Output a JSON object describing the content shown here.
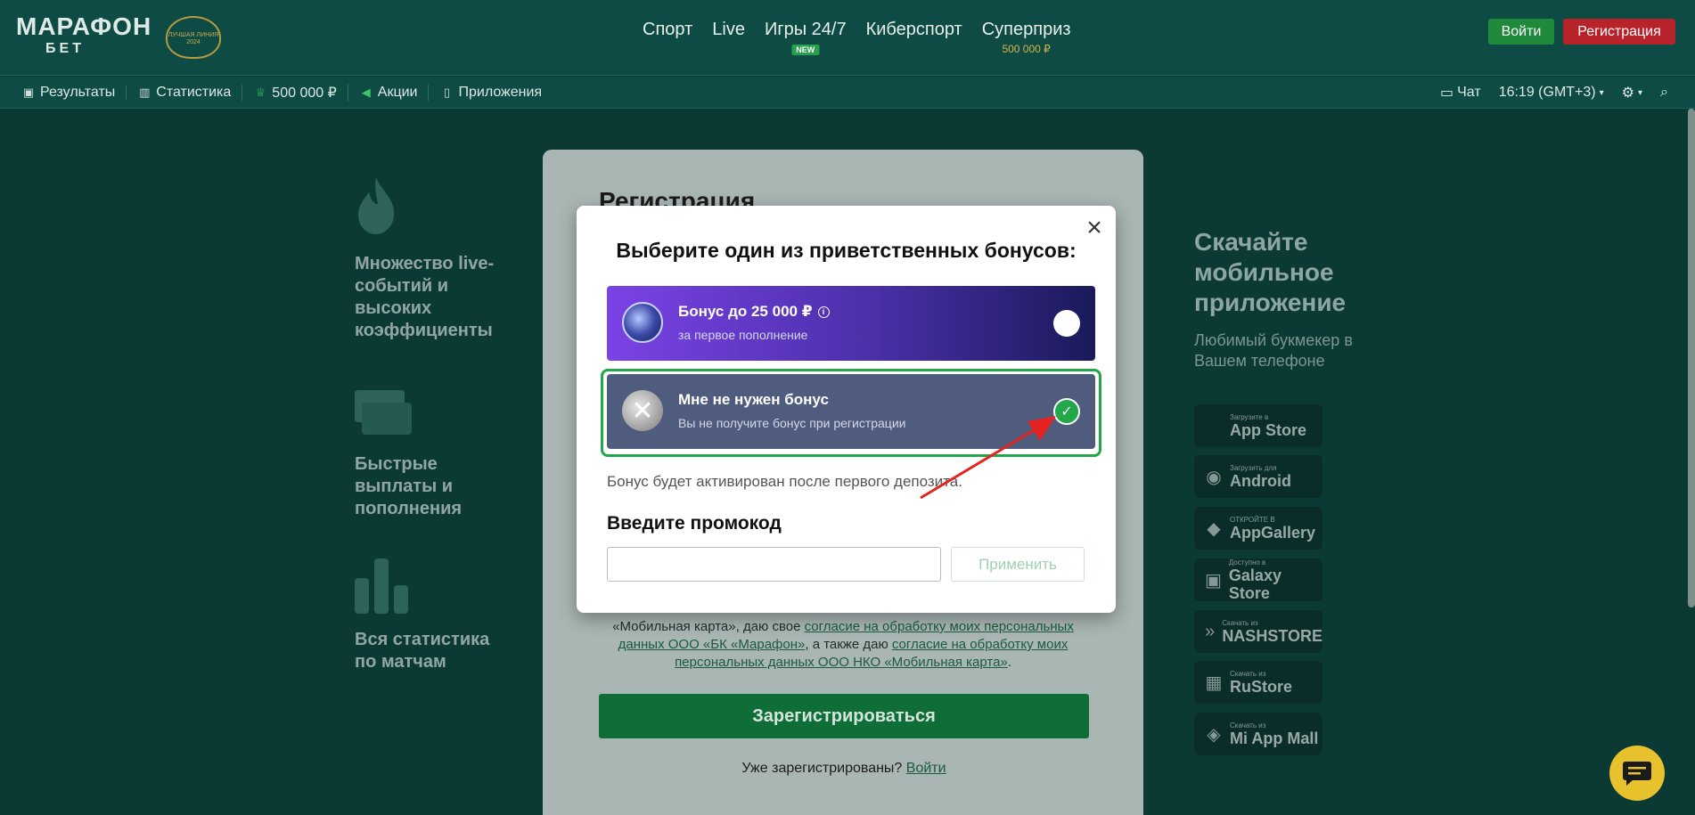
{
  "header": {
    "logo_top": "МАРАФОН",
    "logo_bottom": "БЕТ",
    "award_text": "ЛУЧШАЯ ЛИНИЯ 2024",
    "nav": [
      {
        "label": "Спорт"
      },
      {
        "label": "Live"
      },
      {
        "label": "Игры 24/7",
        "badge": "NEW"
      },
      {
        "label": "Киберспорт"
      },
      {
        "label": "Суперприз",
        "sub": "500 000 ₽"
      }
    ],
    "login_label": "Войти",
    "register_label": "Регистрация"
  },
  "subnav": {
    "left": [
      {
        "label": "Результаты",
        "icon": "results-icon"
      },
      {
        "label": "Статистика",
        "icon": "stats-icon"
      },
      {
        "label": "500 000 ₽",
        "icon": "trophy-icon"
      },
      {
        "label": "Акции",
        "icon": "megaphone-icon"
      },
      {
        "label": "Приложения",
        "icon": "phone-icon"
      }
    ],
    "chat_label": "Чат",
    "time_label": "16:19 (GMT+3)"
  },
  "features": [
    {
      "text": "Множество live-событий и высоких коэффициенты"
    },
    {
      "text": "Быстрые выплаты и пополнения"
    },
    {
      "text": "Вся статистика по матчам"
    }
  ],
  "download": {
    "title": "Скачайте мобильное приложение",
    "subtitle": "Любимый букмекер в Вашем телефоне",
    "stores": [
      {
        "small": "Загрузите в",
        "big": "App Store"
      },
      {
        "small": "Загрузить для",
        "big": "Android"
      },
      {
        "small": "ОТКРОЙТЕ В",
        "big": "AppGallery"
      },
      {
        "small": "Доступно в",
        "big": "Galaxy Store"
      },
      {
        "small": "Скачать из",
        "big": "NASHSTORE"
      },
      {
        "small": "Скачать из",
        "big": "RuStore"
      },
      {
        "small": "Скачать из",
        "big": "Mi App Mall"
      }
    ]
  },
  "registration": {
    "title": "Регистрация",
    "legal_1": "«Мобильная карта», даю свое",
    "legal_link_1": "согласие на обработку моих персональных данных ООО «БК «Марафон»",
    "legal_2": ", а также даю",
    "legal_link_2": "согласие на обработку моих персональных данных ООО НКО «Мобильная карта»",
    "legal_end": ".",
    "submit_label": "Зарегистрироваться",
    "already_text": "Уже зарегистрированы?",
    "already_link": "Войти"
  },
  "modal": {
    "title": "Выберите один из приветственных бонусов:",
    "bonuses": [
      {
        "title": "Бонус до 25 000 ₽",
        "subtitle": "за первое пополнение",
        "selected": false
      },
      {
        "title": "Мне не нужен бонус",
        "subtitle": "Вы не получите бонус при регистрации",
        "selected": true
      }
    ],
    "note": "Бонус будет активирован после первого депозита.",
    "promo_title": "Введите промокод",
    "promo_value": "",
    "apply_label": "Применить"
  },
  "colors": {
    "accent_green": "#22a84a",
    "register_red": "#b8232b",
    "header_bg": "#0e4b45"
  }
}
